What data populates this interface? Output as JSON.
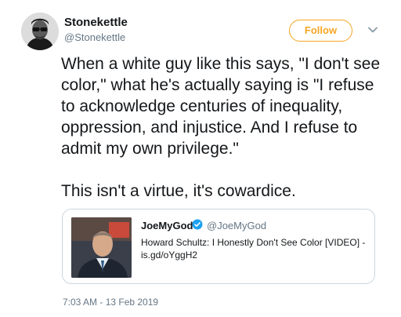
{
  "author": {
    "name": "Stonekettle",
    "handle": "@Stonekettle",
    "avatar_icon": "person-with-glasses-avatar"
  },
  "follow_button": {
    "label": "Follow",
    "color": "#f5a623"
  },
  "menu_icon": "chevron-down-icon",
  "tweet": {
    "text": "When a white guy like this says, \"I don't see color,\" what he's actually saying is \"I refuse to acknowledge centuries of inequality, oppression, and injustice. And I refuse to admit my own privilege.\"\n\nThis isn't a virtue, it's cowardice."
  },
  "quoted_tweet": {
    "name": "JoeMyGod",
    "verified": true,
    "handle": "@JoeMyGod",
    "text": "Howard Schultz: I Honestly Don't See Color [VIDEO] - is.gd/oYggH2",
    "thumbnail_icon": "man-in-suit-photo"
  },
  "timestamp": "7:03 AM - 13 Feb 2019",
  "colors": {
    "text": "#14171a",
    "secondary": "#657786",
    "border": "#ccd6dd",
    "verified": "#1da1f2"
  }
}
